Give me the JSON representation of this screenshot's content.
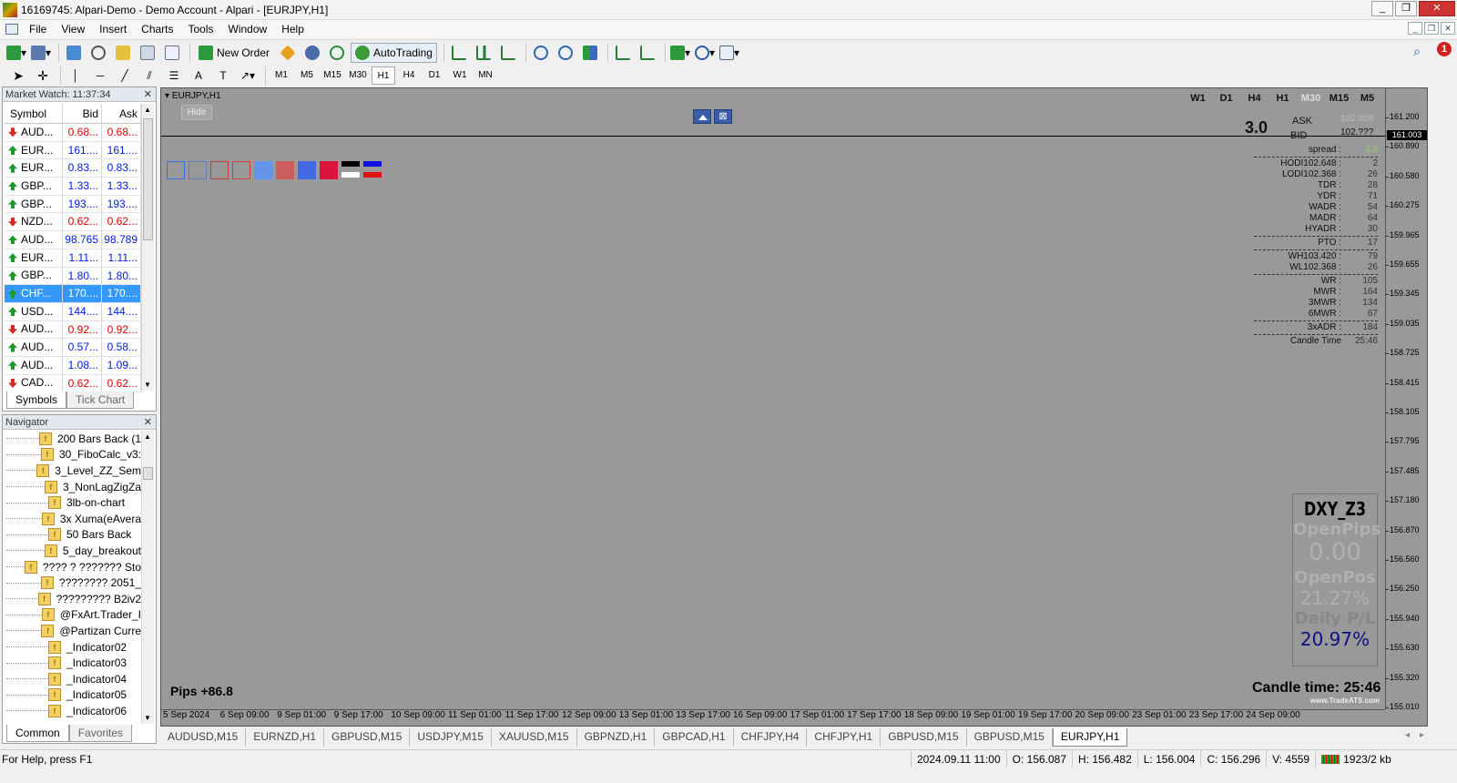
{
  "window": {
    "title": "16169745: Alpari-Demo - Demo Account - Alpari - [EURJPY,H1]"
  },
  "menu": [
    "File",
    "View",
    "Insert",
    "Charts",
    "Tools",
    "Window",
    "Help"
  ],
  "toolbar": {
    "new_order": "New Order",
    "autotrading": "AutoTrading"
  },
  "timeframes": [
    "M1",
    "M5",
    "M15",
    "M30",
    "H1",
    "H4",
    "D1",
    "W1",
    "MN"
  ],
  "active_timeframe": "H1",
  "market_watch": {
    "title": "Market Watch: 11:37:34",
    "headers": {
      "symbol": "Symbol",
      "bid": "Bid",
      "ask": "Ask"
    },
    "rows": [
      {
        "symbol": "AUD...",
        "bid": "0.68...",
        "ask": "0.68...",
        "dir": "down",
        "color": "red"
      },
      {
        "symbol": "EUR...",
        "bid": "161....",
        "ask": "161....",
        "dir": "up",
        "color": "blue"
      },
      {
        "symbol": "EUR...",
        "bid": "0.83...",
        "ask": "0.83...",
        "dir": "up",
        "color": "blue"
      },
      {
        "symbol": "GBP...",
        "bid": "1.33...",
        "ask": "1.33...",
        "dir": "up",
        "color": "blue"
      },
      {
        "symbol": "GBP...",
        "bid": "193....",
        "ask": "193....",
        "dir": "up",
        "color": "blue"
      },
      {
        "symbol": "NZD...",
        "bid": "0.62...",
        "ask": "0.62...",
        "dir": "down",
        "color": "red"
      },
      {
        "symbol": "AUD...",
        "bid": "98.765",
        "ask": "98.789",
        "dir": "up",
        "color": "blue"
      },
      {
        "symbol": "EUR...",
        "bid": "1.11...",
        "ask": "1.11...",
        "dir": "up",
        "color": "blue"
      },
      {
        "symbol": "GBP...",
        "bid": "1.80...",
        "ask": "1.80...",
        "dir": "up",
        "color": "blue"
      },
      {
        "symbol": "CHF...",
        "bid": "170....",
        "ask": "170....",
        "dir": "up",
        "color": "blue",
        "selected": true
      },
      {
        "symbol": "USD...",
        "bid": "144....",
        "ask": "144....",
        "dir": "up",
        "color": "blue"
      },
      {
        "symbol": "AUD...",
        "bid": "0.92...",
        "ask": "0.92...",
        "dir": "down",
        "color": "red"
      },
      {
        "symbol": "AUD...",
        "bid": "0.57...",
        "ask": "0.58...",
        "dir": "up",
        "color": "blue"
      },
      {
        "symbol": "AUD...",
        "bid": "1.08...",
        "ask": "1.09...",
        "dir": "up",
        "color": "blue"
      },
      {
        "symbol": "CAD...",
        "bid": "0.62...",
        "ask": "0.62...",
        "dir": "down",
        "color": "red"
      }
    ],
    "tabs": [
      "Symbols",
      "Tick Chart"
    ]
  },
  "navigator": {
    "title": "Navigator",
    "items": [
      "200 Bars Back (1",
      "30_FiboCalc_v3:",
      "3_Level_ZZ_Sem",
      "3_NonLagZigZa",
      "3lb-on-chart",
      "3x Xuma(eAvera",
      "50 Bars Back",
      "5_day_breakout",
      "???? ? ??????? Sto",
      "???????? 2051_",
      "????????? B2iv2",
      "@FxArt.Trader_I",
      "@Partizan Curre",
      "_Indicator02",
      "_Indicator03",
      "_Indicator04",
      "_Indicator05",
      "_Indicator06"
    ],
    "tabs": [
      "Common",
      "Favorites"
    ]
  },
  "chart": {
    "title": "EURJPY,H1",
    "hide_label": "Hide",
    "tf_row": [
      "W1",
      "D1",
      "H4",
      "H1",
      "M30",
      "M15",
      "M5"
    ],
    "swatch_colors": [
      "#4169e1",
      "#6a7ab8",
      "#c04040",
      "#d04040",
      "#6495ed",
      "#cd5c5c",
      "#4169e1",
      "#dc143c"
    ],
    "spread_big": "3.0",
    "ask_label": "ASK",
    "ask_value": "102.658",
    "bid_label": "BID",
    "bid_value": "102.???",
    "stats": [
      {
        "label": "spread :",
        "value": "3.0"
      },
      {
        "label": "HODI102.648 :",
        "value": "2"
      },
      {
        "label": "LODI102.368 :",
        "value": "26"
      },
      {
        "label": "TDR :",
        "value": "28"
      },
      {
        "label": "YDR :",
        "value": "71"
      },
      {
        "label": "WADR :",
        "value": "54"
      },
      {
        "label": "MADR :",
        "value": "64"
      },
      {
        "label": "HYADR :",
        "value": "30"
      },
      {
        "label": "PTO :",
        "value": "17"
      },
      {
        "label": "WH103.420 :",
        "value": "79"
      },
      {
        "label": "WL102.368 :",
        "value": "26"
      },
      {
        "label": "WR :",
        "value": "105"
      },
      {
        "label": "MWR :",
        "value": "164"
      },
      {
        "label": "3MWR :",
        "value": "134"
      },
      {
        "label": "6MWR :",
        "value": "67"
      },
      {
        "label": "3xADR :",
        "value": "184"
      },
      {
        "label": "Candle Time",
        "value": "25:46"
      }
    ],
    "dxy": {
      "title": "DXY_Z3",
      "open_pips_label": "OpenPips",
      "open_pips": "0.00",
      "open_pos_label": "OpenPos",
      "open_pos": "21.27%",
      "daily_pl_label": "Daily P/L",
      "daily_pl": "20.97%"
    },
    "pips": "Pips +86.8",
    "candle_time": "Candle time:  25:46",
    "watermark": "www.TradeATS.com",
    "price_label": "161.003",
    "y_ticks": [
      "161.200",
      "160.890",
      "160.580",
      "160.275",
      "159.965",
      "159.655",
      "159.345",
      "159.035",
      "158.725",
      "158.415",
      "158.105",
      "157.795",
      "157.485",
      "157.180",
      "156.870",
      "156.560",
      "156.250",
      "155.940",
      "155.630",
      "155.320",
      "155.010"
    ],
    "x_ticks": [
      "5 Sep 2024",
      "6 Sep 09:00",
      "9 Sep 01:00",
      "9 Sep 17:00",
      "10 Sep 09:00",
      "11 Sep 01:00",
      "11 Sep 17:00",
      "12 Sep 09:00",
      "13 Sep 01:00",
      "13 Sep 17:00",
      "16 Sep 09:00",
      "17 Sep 01:00",
      "17 Sep 17:00",
      "18 Sep 09:00",
      "19 Sep 01:00",
      "19 Sep 17:00",
      "20 Sep 09:00",
      "23 Sep 01:00",
      "23 Sep 17:00",
      "24 Sep 09:00"
    ]
  },
  "chart_tabs": [
    "AUDUSD,M15",
    "EURNZD,H1",
    "GBPUSD,M15",
    "USDJPY,M15",
    "XAUUSD,M15",
    "GBPNZD,H1",
    "GBPCAD,H1",
    "CHFJPY,H4",
    "CHFJPY,H1",
    "GBPUSD,M15",
    "GBPUSD,M15",
    "EURJPY,H1"
  ],
  "status": {
    "help": "For Help, press F1",
    "datetime": "2024.09.11 11:00",
    "open": "O: 156.087",
    "high": "H: 156.482",
    "low": "L: 156.004",
    "close": "C: 156.296",
    "volume": "V: 4559",
    "traffic": "1923/2 kb"
  }
}
